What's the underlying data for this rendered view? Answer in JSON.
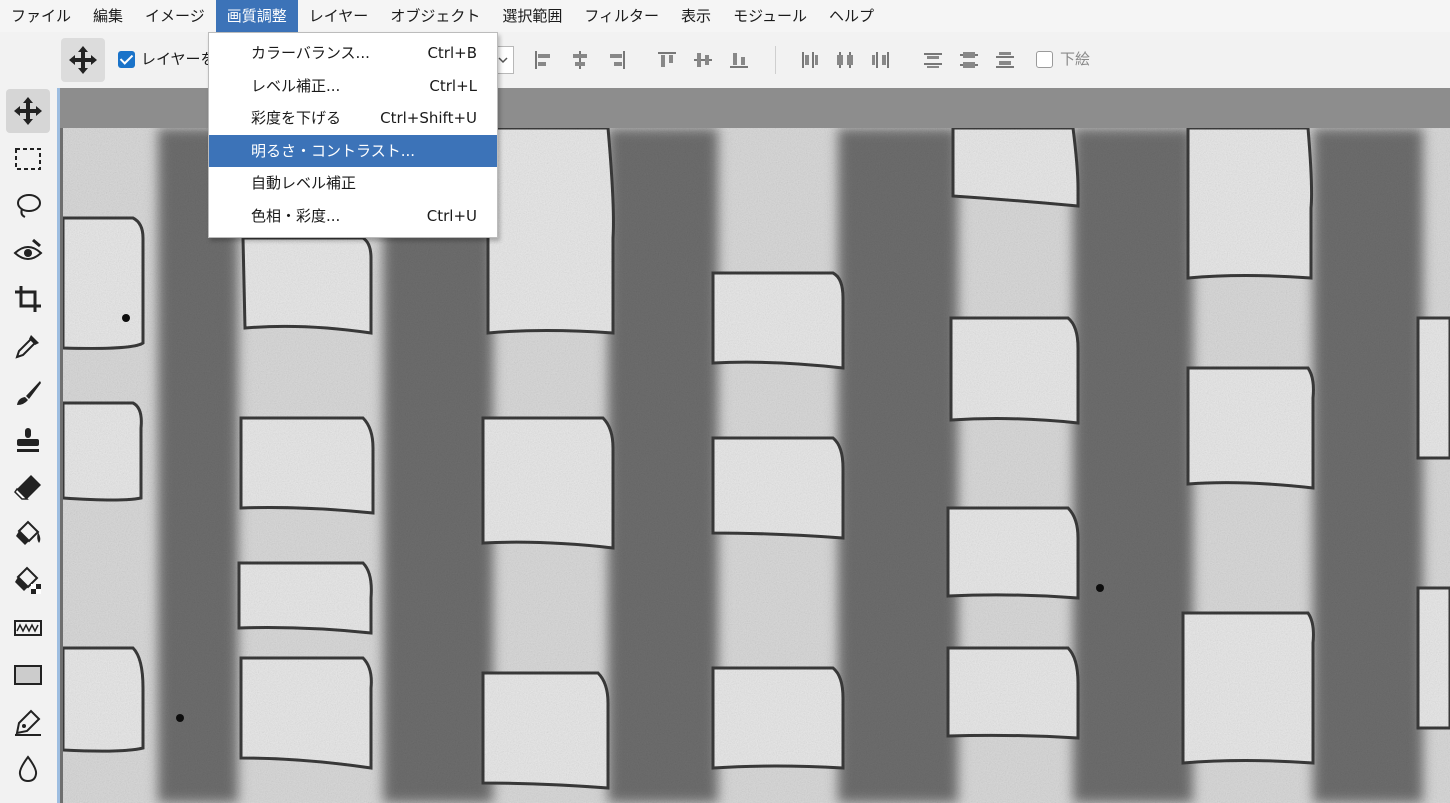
{
  "menubar": {
    "items": [
      {
        "label": "ファイル"
      },
      {
        "label": "編集"
      },
      {
        "label": "イメージ"
      },
      {
        "label": "画質調整",
        "active": true
      },
      {
        "label": "レイヤー"
      },
      {
        "label": "オブジェクト"
      },
      {
        "label": "選択範囲"
      },
      {
        "label": "フィルター"
      },
      {
        "label": "表示"
      },
      {
        "label": "モジュール"
      },
      {
        "label": "ヘルプ"
      }
    ]
  },
  "options": {
    "auto_select_label": "レイヤーを",
    "auto_select_checked": true,
    "transform_label": "下絵",
    "transform_checked": false
  },
  "adjust_menu": {
    "items": [
      {
        "label": "カラーバランス...",
        "shortcut": "Ctrl+B"
      },
      {
        "label": "レベル補正...",
        "shortcut": "Ctrl+L"
      },
      {
        "label": "彩度を下げる",
        "shortcut": "Ctrl+Shift+U"
      },
      {
        "label": "明るさ・コントラスト...",
        "shortcut": "",
        "highlighted": true
      },
      {
        "label": "自動レベル補正",
        "shortcut": ""
      },
      {
        "label": "色相・彩度...",
        "shortcut": "Ctrl+U"
      }
    ]
  },
  "tools": [
    {
      "icon": "move-tool-icon",
      "active": true
    },
    {
      "icon": "rectangle-select-icon"
    },
    {
      "icon": "lasso-icon"
    },
    {
      "icon": "red-eye-icon"
    },
    {
      "icon": "crop-icon"
    },
    {
      "icon": "eyedropper-icon"
    },
    {
      "icon": "brush-icon"
    },
    {
      "icon": "clone-stamp-icon"
    },
    {
      "icon": "eraser-icon"
    },
    {
      "icon": "paint-bucket-icon"
    },
    {
      "icon": "gradient-fill-icon"
    },
    {
      "icon": "wave-icon"
    },
    {
      "icon": "rectangle-shape-icon"
    },
    {
      "icon": "pen-icon"
    },
    {
      "icon": "blur-drop-icon"
    }
  ],
  "colors": {
    "menu_highlight": "#3c73b8",
    "checkbox_blue": "#1a73c9",
    "workspace_border": "#9dbde0"
  }
}
